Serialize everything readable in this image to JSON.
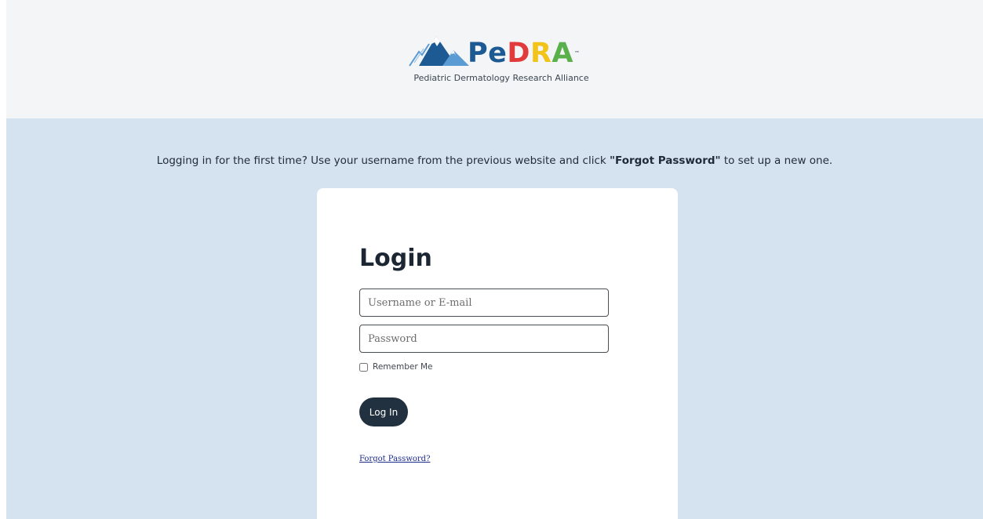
{
  "header": {
    "logo": {
      "name": "PeDRA",
      "name_parts": [
        "Pe",
        "D",
        "R",
        "A"
      ],
      "tagline": "Pediatric Dermatology Research Alliance"
    }
  },
  "notice": {
    "before": "Logging in for the first time? Use your username from the previous website and click ",
    "emphasis": "\"Forgot Password\"",
    "after": " to set up a new one."
  },
  "login": {
    "title": "Login",
    "username_placeholder": "Username or E-mail",
    "username_value": "",
    "password_placeholder": "Password",
    "password_value": "",
    "remember_label": "Remember Me",
    "remember_checked": false,
    "submit_label": "Log In",
    "forgot_link": "Forgot Password?"
  },
  "colors": {
    "header_bg": "#f3f5f7",
    "main_bg": "#d5e2ef",
    "button_bg": "#22313f",
    "logo_navy": "#1d5a93",
    "logo_d": "#e23b3b",
    "logo_r": "#f2c318",
    "logo_a": "#5ab04b",
    "link": "#1a2a8c"
  },
  "icons": {
    "logo_mark": "mountain-icon"
  }
}
